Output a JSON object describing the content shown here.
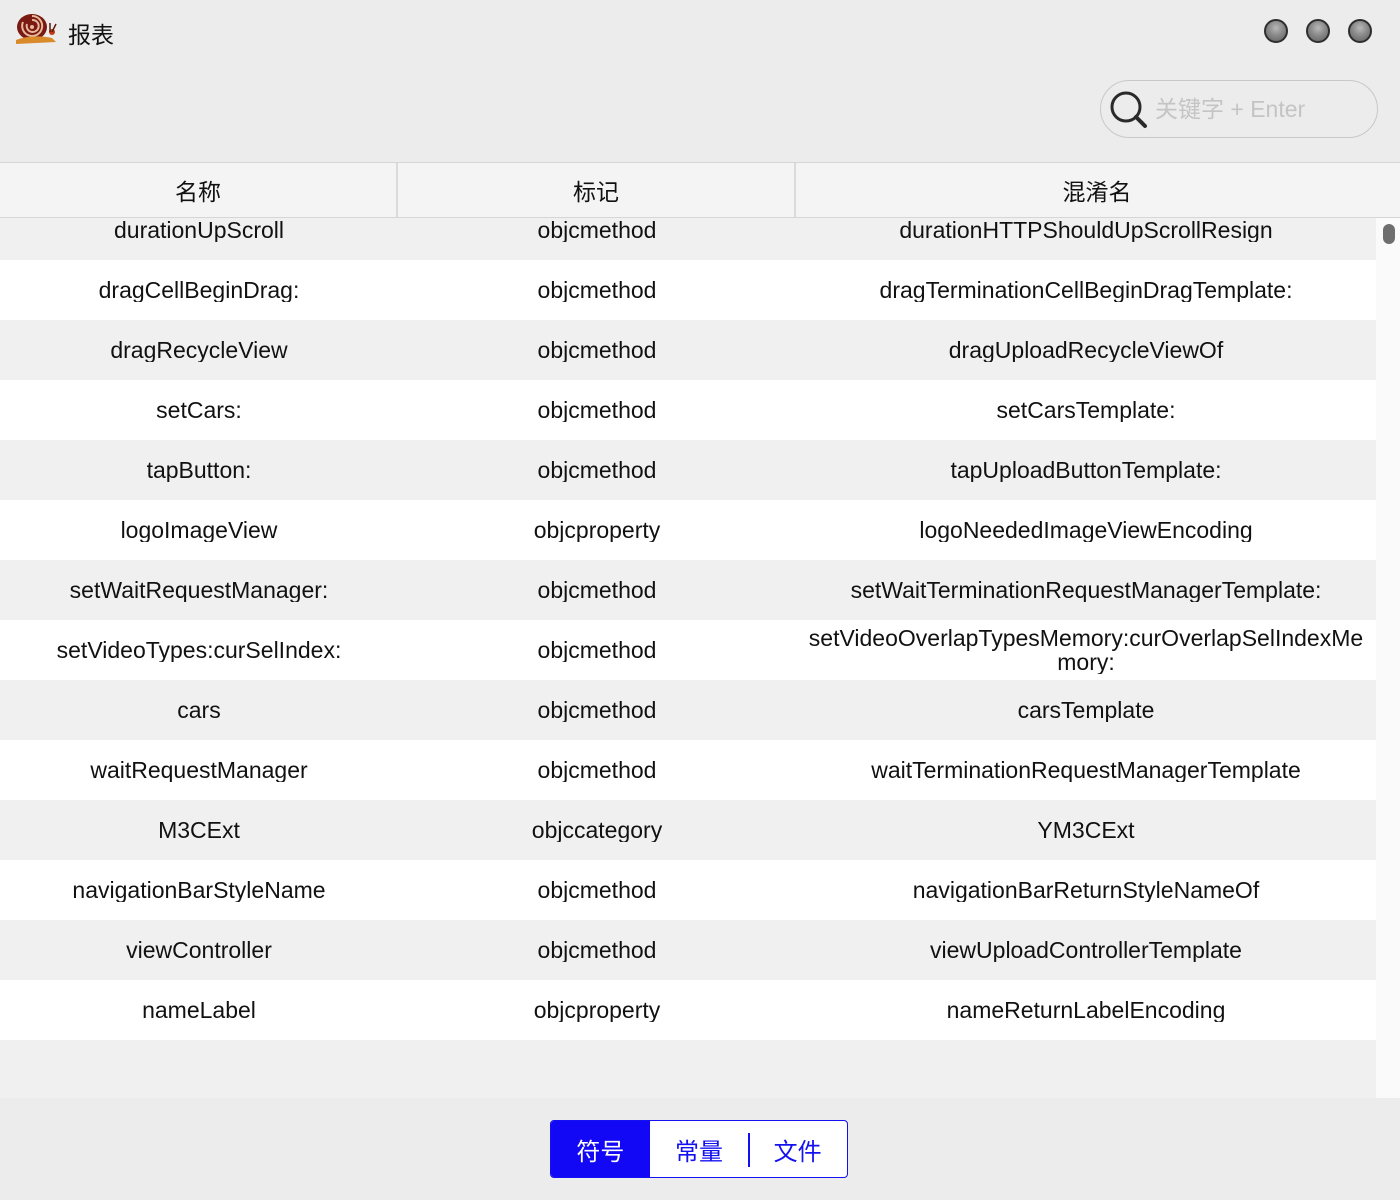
{
  "window": {
    "title": "报表"
  },
  "search": {
    "placeholder": "关键字 + Enter",
    "value": ""
  },
  "table": {
    "columns": [
      "名称",
      "标记",
      "混淆名"
    ],
    "rows": [
      [
        "durationUpScroll",
        "objcmethod",
        "durationHTTPShouldUpScrollResign"
      ],
      [
        "dragCellBeginDrag:",
        "objcmethod",
        "dragTerminationCellBeginDragTemplate:"
      ],
      [
        "dragRecycleView",
        "objcmethod",
        "dragUploadRecycleViewOf"
      ],
      [
        "setCars:",
        "objcmethod",
        "setCarsTemplate:"
      ],
      [
        "tapButton:",
        "objcmethod",
        "tapUploadButtonTemplate:"
      ],
      [
        "logoImageView",
        "objcproperty",
        "logoNeededImageViewEncoding"
      ],
      [
        "setWaitRequestManager:",
        "objcmethod",
        "setWaitTerminationRequestManagerTemplate:"
      ],
      [
        "setVideoTypes:curSelIndex:",
        "objcmethod",
        "setVideoOverlapTypesMemory:curOverlapSelIndexMemory:"
      ],
      [
        "cars",
        "objcmethod",
        "carsTemplate"
      ],
      [
        "waitRequestManager",
        "objcmethod",
        "waitTerminationRequestManagerTemplate"
      ],
      [
        "M3CExt",
        "objccategory",
        "YM3CExt"
      ],
      [
        "navigationBarStyleName",
        "objcmethod",
        "navigationBarReturnStyleNameOf"
      ],
      [
        "viewController",
        "objcmethod",
        "viewUploadControllerTemplate"
      ],
      [
        "nameLabel",
        "objcproperty",
        "nameReturnLabelEncoding"
      ]
    ]
  },
  "tabs": [
    {
      "label": "符号",
      "active": true
    },
    {
      "label": "常量",
      "active": false
    },
    {
      "label": "文件",
      "active": false
    }
  ],
  "colors": {
    "accent": "#1208f5",
    "background": "#ececec",
    "row_alt": "#f0f0f0"
  }
}
